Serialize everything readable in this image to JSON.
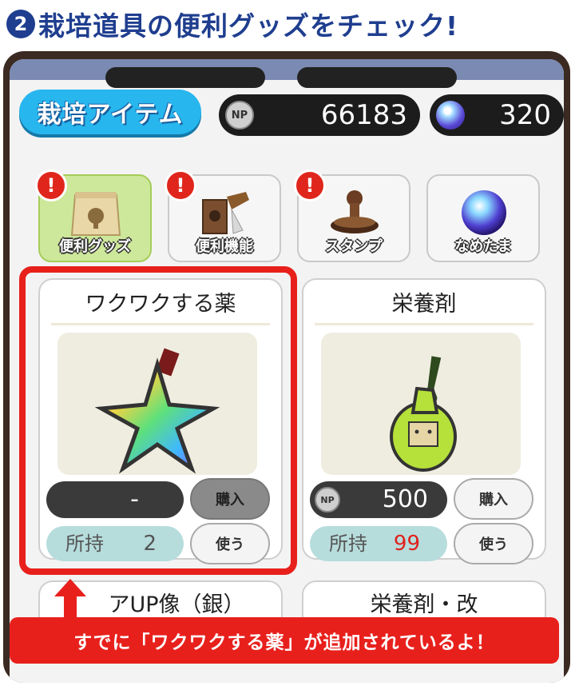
{
  "heading": {
    "number": "2",
    "text": "栽培道具の便利グッズをチェック!"
  },
  "title_tab": "栽培アイテム",
  "currency": {
    "np_icon": "NP",
    "np_value": "66183",
    "orb_value": "320"
  },
  "categories": [
    {
      "label": "便利グッズ",
      "alert": "!",
      "icon": "bag-icon"
    },
    {
      "label": "便利機能",
      "alert": "!",
      "icon": "tools-icon"
    },
    {
      "label": "スタンプ",
      "alert": "!",
      "icon": "stamp-icon"
    },
    {
      "label": "なめたま",
      "alert": "",
      "icon": "orb-icon"
    }
  ],
  "items": [
    {
      "name": "ワクワクする薬",
      "price": "-",
      "buy_label": "購入",
      "own_label": "所持",
      "own_count": "2",
      "use_label": "使う",
      "icon": "star-potion-icon"
    },
    {
      "name": "栄養剤",
      "price": "500",
      "price_icon": "NP",
      "buy_label": "購入",
      "own_label": "所持",
      "own_count": "99",
      "own_count_color": "#e0201c",
      "use_label": "使う",
      "icon": "green-bottle-icon"
    }
  ],
  "lower_items": [
    {
      "name": "アUP像（銀）"
    },
    {
      "name": "栄養剤・改"
    }
  ],
  "callout": "すでに「ワクワクする薬」が追加されているよ！",
  "colors": {
    "accent_red": "#e8201c",
    "heading_blue": "#1f3e8f",
    "tab_blue": "#27b6ee"
  }
}
